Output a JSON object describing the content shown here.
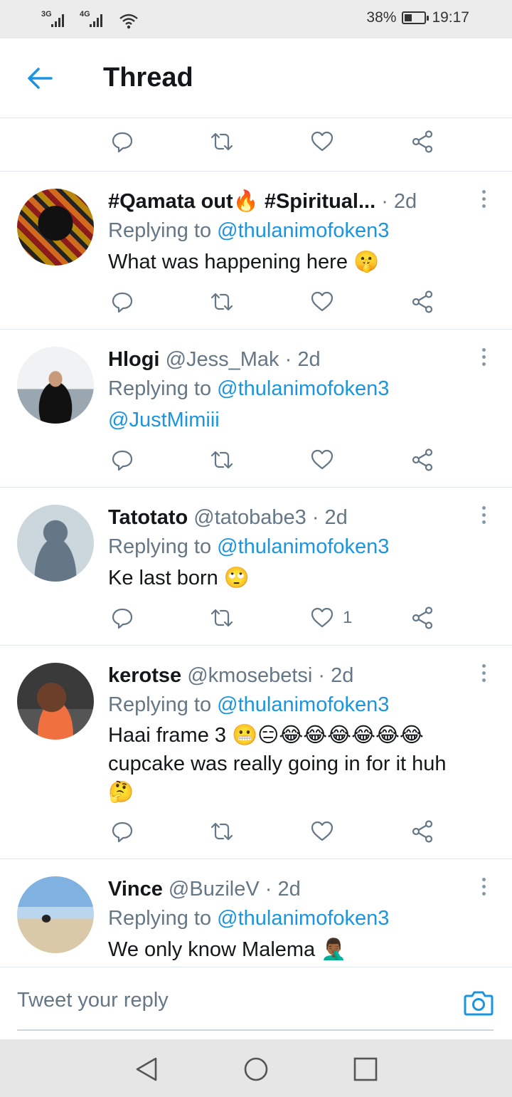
{
  "status_bar": {
    "network_1": "3G",
    "network_2": "4G",
    "battery_percent": "38%",
    "battery_level": 0.38,
    "time": "19:17"
  },
  "header": {
    "title": "Thread",
    "back_icon": "arrow-left-icon"
  },
  "actions": {
    "reply_icon": "reply-icon",
    "retweet_icon": "retweet-icon",
    "like_icon": "heart-icon",
    "share_icon": "share-icon"
  },
  "tweets": [
    {
      "name": "#Qamata out🔥 #Spiritual...",
      "handle": "",
      "time": "· 2d",
      "replying_prefix": "Replying to",
      "replying_to": "@thulanimofoken3",
      "text": "What was happening here 🤫",
      "likes": ""
    },
    {
      "name": "Hlogi",
      "handle": "@Jess_Mak",
      "time": "· 2d",
      "replying_prefix": "Replying to",
      "replying_to": "@thulanimofoken3",
      "text": "@JustMimiii",
      "likes": ""
    },
    {
      "name": "Tatotato",
      "handle": "@tatobabe3",
      "time": "· 2d",
      "replying_prefix": "Replying to",
      "replying_to": "@thulanimofoken3",
      "text": "Ke last born 🙄",
      "likes": "1"
    },
    {
      "name": "kerotse",
      "handle": "@kmosebetsi",
      "time": "· 2d",
      "replying_prefix": "Replying to",
      "replying_to": "@thulanimofoken3",
      "text": "Haai frame 3 😬😑😂😂😂😂😂😂 cupcake was really going in for it huh 🤔",
      "likes": ""
    },
    {
      "name": "Vince",
      "handle": "@BuzileV",
      "time": "· 2d",
      "replying_prefix": "Replying to",
      "replying_to": "@thulanimofoken3",
      "text": "We only know Malema 🤦🏾‍♂️",
      "likes": ""
    }
  ],
  "compose": {
    "placeholder": "Tweet your reply",
    "camera_icon": "camera-icon"
  },
  "nav_bar": {
    "back_icon": "triangle-back-icon",
    "home_icon": "circle-home-icon",
    "recents_icon": "square-recents-icon"
  },
  "colors": {
    "accent": "#1b95e0",
    "secondary_text": "#657786",
    "divider": "#e1e8ed"
  }
}
